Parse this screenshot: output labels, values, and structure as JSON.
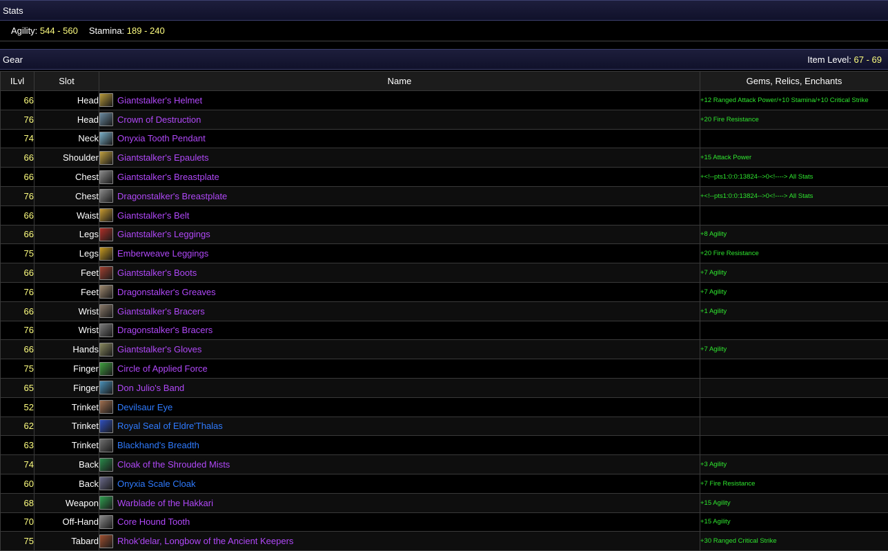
{
  "stats_header": {
    "title": "Stats"
  },
  "stats": [
    {
      "label": "Agility:",
      "value": "544 - 560"
    },
    {
      "label": "Stamina:",
      "value": "189 - 240"
    }
  ],
  "gear_header": {
    "title": "Gear",
    "item_level_label": "Item Level:",
    "item_level_value": "67 - 69"
  },
  "columns": {
    "ilvl": "ILvl",
    "slot": "Slot",
    "name": "Name",
    "enchants": "Gems, Relics, Enchants"
  },
  "colors": {
    "epic": "#b048f8",
    "rare": "#2f7bff",
    "enchant": "#2fe62f",
    "ilvl": "#ffff80"
  },
  "items": [
    {
      "ilvl": "66",
      "slot": "Head",
      "name": "Giantstalker's Helmet",
      "quality": "epic",
      "enchant": "+12 Ranged Attack Power/+10 Stamina/+10 Critical Strike",
      "icon": "helmet-icon",
      "icon_color": "#b89a3a"
    },
    {
      "ilvl": "76",
      "slot": "Head",
      "name": "Crown of Destruction",
      "quality": "epic",
      "enchant": "+20 Fire Resistance",
      "icon": "crown-icon",
      "icon_color": "#6a8aa0"
    },
    {
      "ilvl": "74",
      "slot": "Neck",
      "name": "Onyxia Tooth Pendant",
      "quality": "epic",
      "enchant": "",
      "icon": "pendant-icon",
      "icon_color": "#7ab0c8"
    },
    {
      "ilvl": "66",
      "slot": "Shoulder",
      "name": "Giantstalker's Epaulets",
      "quality": "epic",
      "enchant": "+15 Attack Power",
      "icon": "shoulder-icon",
      "icon_color": "#c0a040"
    },
    {
      "ilvl": "66",
      "slot": "Chest",
      "name": "Giantstalker's Breastplate",
      "quality": "epic",
      "enchant": "+<!--pts1:0:0:13824-->0<!----> All Stats",
      "icon": "chest-icon",
      "icon_color": "#8a8a8a"
    },
    {
      "ilvl": "76",
      "slot": "Chest",
      "name": "Dragonstalker's Breastplate",
      "quality": "epic",
      "enchant": "+<!--pts1:0:0:13824-->0<!----> All Stats",
      "icon": "chest-icon",
      "icon_color": "#8a8a8a"
    },
    {
      "ilvl": "66",
      "slot": "Waist",
      "name": "Giantstalker's Belt",
      "quality": "epic",
      "enchant": "",
      "icon": "belt-icon",
      "icon_color": "#c89a30"
    },
    {
      "ilvl": "66",
      "slot": "Legs",
      "name": "Giantstalker's Leggings",
      "quality": "epic",
      "enchant": "+8 Agility",
      "icon": "leggings-icon",
      "icon_color": "#b03028"
    },
    {
      "ilvl": "75",
      "slot": "Legs",
      "name": "Emberweave Leggings",
      "quality": "epic",
      "enchant": "+20 Fire Resistance",
      "icon": "leggings-icon",
      "icon_color": "#c89a20"
    },
    {
      "ilvl": "66",
      "slot": "Feet",
      "name": "Giantstalker's Boots",
      "quality": "epic",
      "enchant": "+7 Agility",
      "icon": "boots-icon",
      "icon_color": "#a04030"
    },
    {
      "ilvl": "76",
      "slot": "Feet",
      "name": "Dragonstalker's Greaves",
      "quality": "epic",
      "enchant": "+7 Agility",
      "icon": "boots-icon",
      "icon_color": "#a08a70"
    },
    {
      "ilvl": "66",
      "slot": "Wrist",
      "name": "Giantstalker's Bracers",
      "quality": "epic",
      "enchant": "+1 Agility",
      "icon": "bracers-icon",
      "icon_color": "#8a7a6a"
    },
    {
      "ilvl": "76",
      "slot": "Wrist",
      "name": "Dragonstalker's Bracers",
      "quality": "epic",
      "enchant": "",
      "icon": "bracers-icon",
      "icon_color": "#7a7a7a"
    },
    {
      "ilvl": "66",
      "slot": "Hands",
      "name": "Giantstalker's Gloves",
      "quality": "epic",
      "enchant": "+7 Agility",
      "icon": "gloves-icon",
      "icon_color": "#8a8a60"
    },
    {
      "ilvl": "75",
      "slot": "Finger",
      "name": "Circle of Applied Force",
      "quality": "epic",
      "enchant": "",
      "icon": "ring-icon",
      "icon_color": "#40a040"
    },
    {
      "ilvl": "65",
      "slot": "Finger",
      "name": "Don Julio's Band",
      "quality": "epic",
      "enchant": "",
      "icon": "ring-icon",
      "icon_color": "#4a90b8"
    },
    {
      "ilvl": "52",
      "slot": "Trinket",
      "name": "Devilsaur Eye",
      "quality": "rare",
      "enchant": "",
      "icon": "eye-icon",
      "icon_color": "#a07050"
    },
    {
      "ilvl": "62",
      "slot": "Trinket",
      "name": "Royal Seal of Eldre'Thalas",
      "quality": "rare",
      "enchant": "",
      "icon": "seal-icon",
      "icon_color": "#3050c0"
    },
    {
      "ilvl": "63",
      "slot": "Trinket",
      "name": "Blackhand's Breadth",
      "quality": "rare",
      "enchant": "",
      "icon": "trinket-icon",
      "icon_color": "#707070"
    },
    {
      "ilvl": "74",
      "slot": "Back",
      "name": "Cloak of the Shrouded Mists",
      "quality": "epic",
      "enchant": "+3 Agility",
      "icon": "cloak-icon",
      "icon_color": "#2a8a4a"
    },
    {
      "ilvl": "60",
      "slot": "Back",
      "name": "Onyxia Scale Cloak",
      "quality": "rare",
      "enchant": "+7 Fire Resistance",
      "icon": "cloak-icon",
      "icon_color": "#6a6a8a"
    },
    {
      "ilvl": "68",
      "slot": "Weapon",
      "name": "Warblade of the Hakkari",
      "quality": "epic",
      "enchant": "+15 Agility",
      "icon": "sword-icon",
      "icon_color": "#30a050"
    },
    {
      "ilvl": "70",
      "slot": "Off-Hand",
      "name": "Core Hound Tooth",
      "quality": "epic",
      "enchant": "+15 Agility",
      "icon": "dagger-icon",
      "icon_color": "#8a8a8a"
    },
    {
      "ilvl": "75",
      "slot": "Tabard",
      "name": "Rhok'delar, Longbow of the Ancient Keepers",
      "quality": "epic",
      "enchant": "+30 Ranged Critical Strike",
      "icon": "bow-icon",
      "icon_color": "#a05030"
    }
  ]
}
